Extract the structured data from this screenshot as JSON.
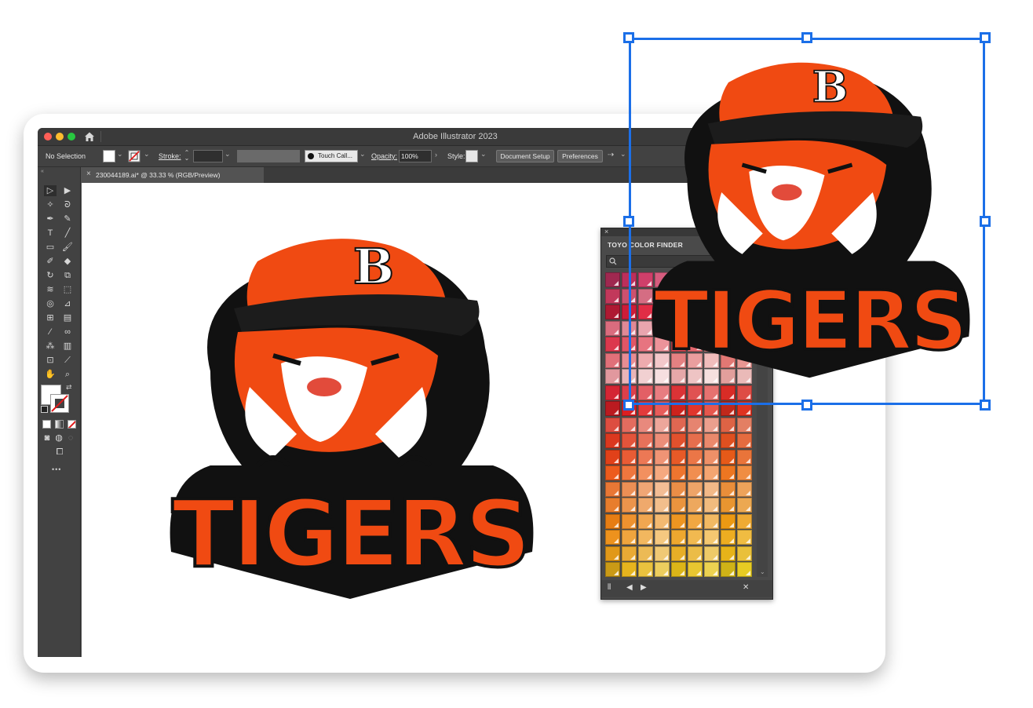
{
  "window": {
    "app_title": "Adobe Illustrator 2023"
  },
  "control_bar": {
    "selection_label": "No Selection",
    "stroke_label": "Stroke:",
    "brush_label": "Touch Call...",
    "opacity_label": "Opacity:",
    "opacity_value": "100%",
    "style_label": "Style:",
    "document_setup_label": "Document Setup",
    "preferences_label": "Preferences"
  },
  "document_tab": {
    "close_glyph": "×",
    "title": "230044189.ai* @ 33.33 % (RGB/Preview)"
  },
  "toolbar": {
    "more_glyph": "•••"
  },
  "artwork": {
    "cap_letter": "B",
    "wordmark": "TIGERS"
  },
  "toyo_panel": {
    "title": "TOYO COLOR FINDER"
  },
  "colors": {
    "accent_selection": "#1b6fe8",
    "tiger_orange": "#f04a12",
    "ink_black": "#111111"
  },
  "icons": [
    "home-icon",
    "selection-tool-icon",
    "direct-selection-icon",
    "pen-tool-icon",
    "type-tool-icon",
    "brush-icon",
    "hand-icon",
    "zoom-icon",
    "search-icon",
    "library-icon",
    "prev-arrow-icon",
    "next-arrow-icon",
    "swatch-options-icon"
  ]
}
